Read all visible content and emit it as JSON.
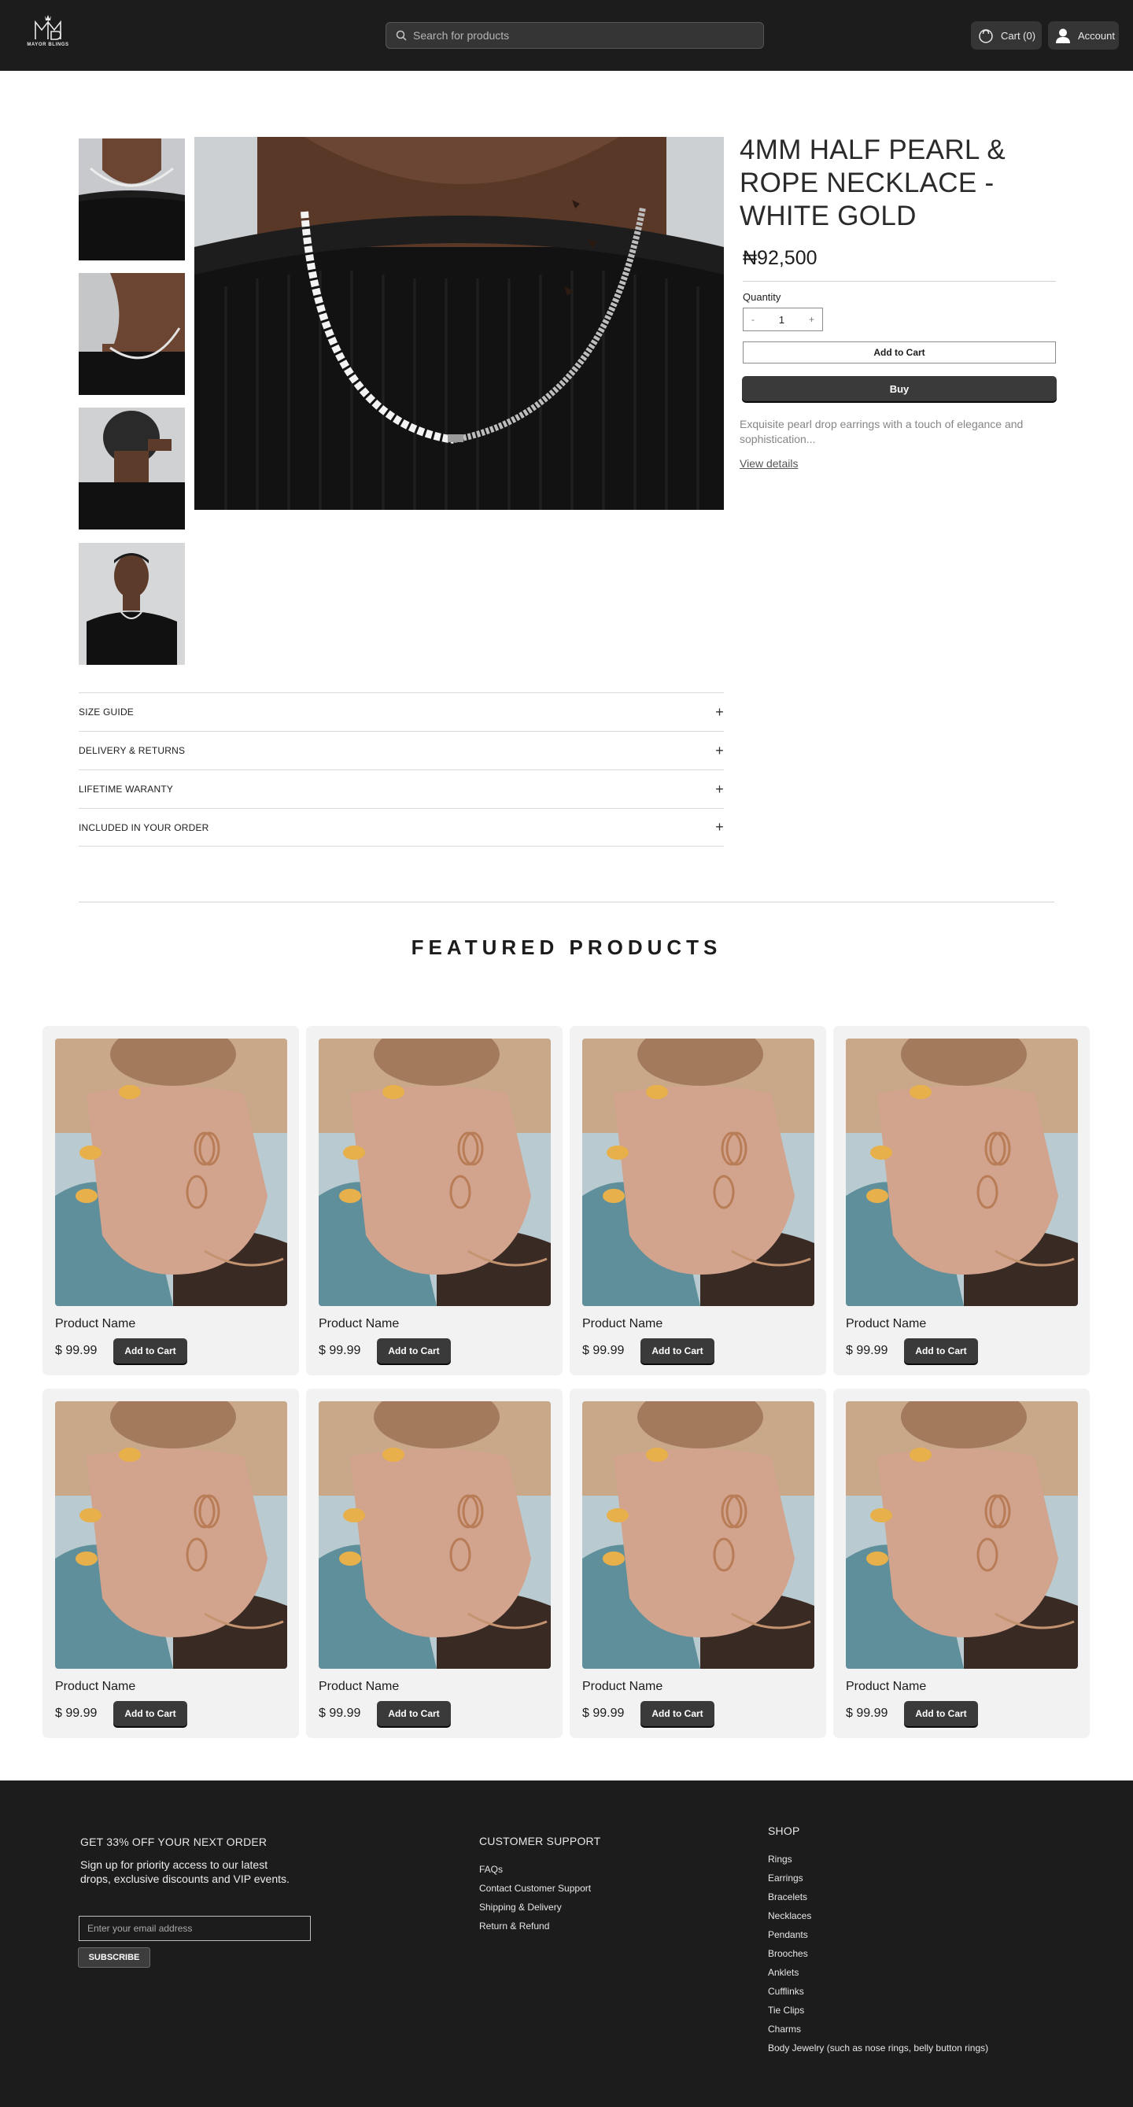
{
  "header": {
    "logo_text": "MAYOR BLINGS",
    "search_placeholder": "Search for products",
    "cart_label": "Cart (0)",
    "account_label": "Account"
  },
  "product": {
    "title": "4MM HALF PEARL & ROPE NECKLACE - WHITE GOLD",
    "price": "₦92,500",
    "quantity_label": "Quantity",
    "quantity_value": "1",
    "decrement": "-",
    "increment": "+",
    "add_to_cart": "Add to Cart",
    "buy": "Buy",
    "description": "Exquisite pearl drop earrings with a touch of elegance and sophistication...",
    "view_details": "View details",
    "accordion": [
      "SIZE GUIDE",
      "DELIVERY & RETURNS",
      "LIFETIME WARANTY",
      "INCLUDED IN YOUR ORDER"
    ]
  },
  "featured": {
    "title": "FEATURED PRODUCTS",
    "items": [
      {
        "name": "Product Name",
        "price": "$ 99.99",
        "button": "Add to Cart"
      },
      {
        "name": "Product Name",
        "price": "$ 99.99",
        "button": "Add to Cart"
      },
      {
        "name": "Product Name",
        "price": "$ 99.99",
        "button": "Add to Cart"
      },
      {
        "name": "Product Name",
        "price": "$ 99.99",
        "button": "Add to Cart"
      },
      {
        "name": "Product Name",
        "price": "$ 99.99",
        "button": "Add to Cart"
      },
      {
        "name": "Product Name",
        "price": "$ 99.99",
        "button": "Add to Cart"
      },
      {
        "name": "Product Name",
        "price": "$ 99.99",
        "button": "Add to Cart"
      },
      {
        "name": "Product Name",
        "price": "$ 99.99",
        "button": "Add to Cart"
      }
    ]
  },
  "footer": {
    "promo_heading": "GET 33% OFF YOUR NEXT ORDER",
    "promo_text": "Sign up for priority access to our latest drops, exclusive discounts and VIP events.",
    "email_placeholder": "Enter your email address",
    "subscribe": "SUBSCRIBE",
    "support_heading": "CUSTOMER SUPPORT",
    "support_links": [
      "FAQs",
      "Contact Customer Support",
      "Shipping & Delivery",
      "Return & Refund"
    ],
    "shop_heading": "SHOP",
    "shop_links": [
      "Rings",
      "Earrings",
      "Bracelets",
      "Necklaces",
      "Pendants",
      "Brooches",
      "Anklets",
      "Cufflinks",
      "Tie Clips",
      "Charms",
      "Body Jewelry (such as nose rings, belly button rings)"
    ]
  },
  "colors": {
    "header_bg": "#1c1c1c",
    "button_dark": "#3a3a3a",
    "card_bg": "#f2f2f2"
  },
  "icons": [
    "search-icon",
    "cart-icon",
    "user-icon",
    "plus-icon",
    "logo-icon"
  ]
}
